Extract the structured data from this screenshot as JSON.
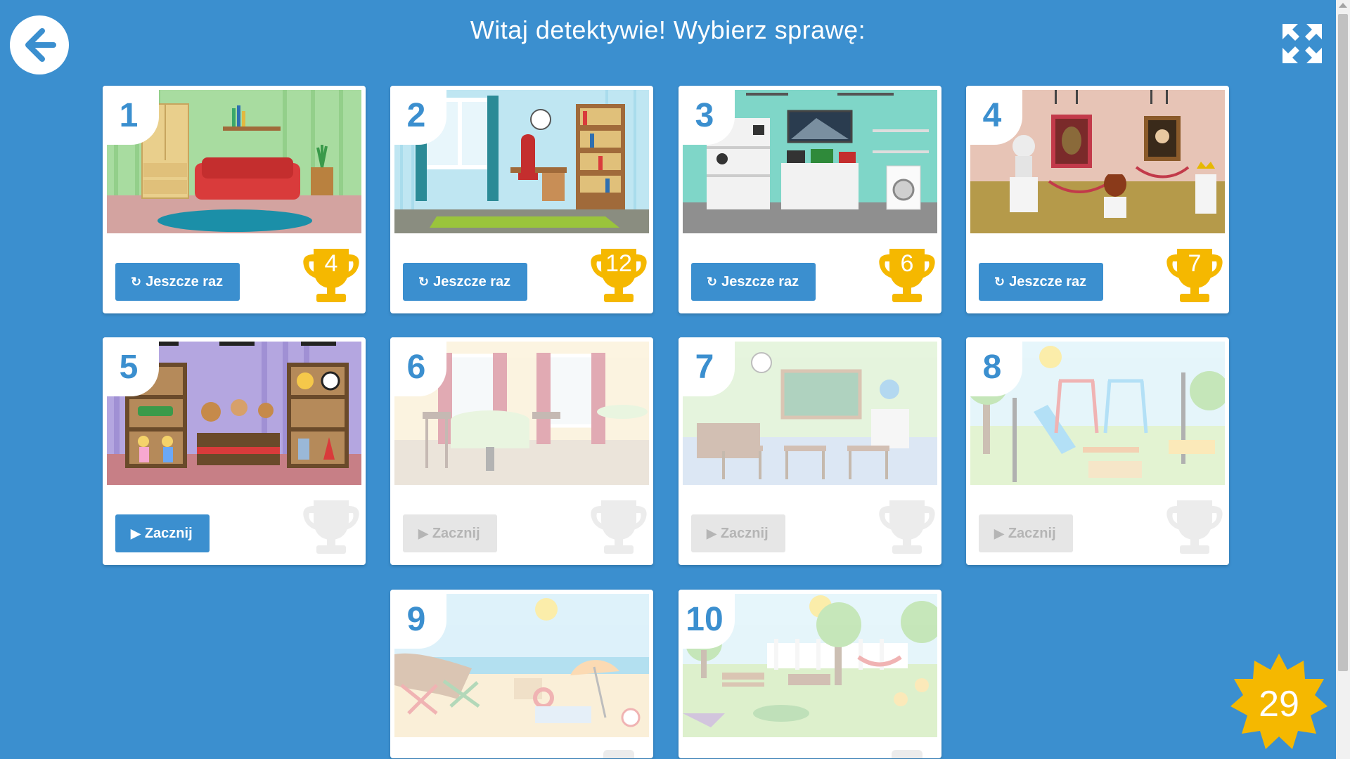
{
  "header": {
    "title": "Witaj detektywie! Wybierz sprawę:"
  },
  "icons": {
    "back": "arrow-left-icon",
    "fullscreen": "expand-arrows-icon",
    "replay": "rotate-icon",
    "play": "play-icon",
    "trophy": "trophy-icon",
    "star": "star-icon"
  },
  "colors": {
    "background": "#3b8fcf",
    "accent": "#3b8fcf",
    "trophy_active": "#f5b800",
    "trophy_inactive": "#ececec"
  },
  "cases": [
    {
      "number": "1",
      "scene": "living-room",
      "button": "Jeszcze raz",
      "button_icon": "replay",
      "score": "4",
      "locked": false,
      "active": true
    },
    {
      "number": "2",
      "scene": "study-room",
      "button": "Jeszcze raz",
      "button_icon": "replay",
      "score": "12",
      "locked": false,
      "active": true
    },
    {
      "number": "3",
      "scene": "electronics-store",
      "button": "Jeszcze raz",
      "button_icon": "replay",
      "score": "6",
      "locked": false,
      "active": true
    },
    {
      "number": "4",
      "scene": "museum",
      "button": "Jeszcze raz",
      "button_icon": "replay",
      "score": "7",
      "locked": false,
      "active": true
    },
    {
      "number": "5",
      "scene": "toy-store",
      "button": "Zacznij",
      "button_icon": "play",
      "score": "",
      "locked": false,
      "active": false
    },
    {
      "number": "6",
      "scene": "cafe",
      "button": "Zacznij",
      "button_icon": "play",
      "score": "",
      "locked": true,
      "active": false
    },
    {
      "number": "7",
      "scene": "classroom",
      "button": "Zacznij",
      "button_icon": "play",
      "score": "",
      "locked": true,
      "active": false
    },
    {
      "number": "8",
      "scene": "playground",
      "button": "Zacznij",
      "button_icon": "play",
      "score": "",
      "locked": true,
      "active": false
    },
    {
      "number": "9",
      "scene": "beach",
      "button": "",
      "button_icon": "",
      "score": "",
      "locked": true,
      "active": false
    },
    {
      "number": "10",
      "scene": "garden",
      "button": "",
      "button_icon": "",
      "score": "",
      "locked": true,
      "active": false
    }
  ],
  "total_score": "29"
}
